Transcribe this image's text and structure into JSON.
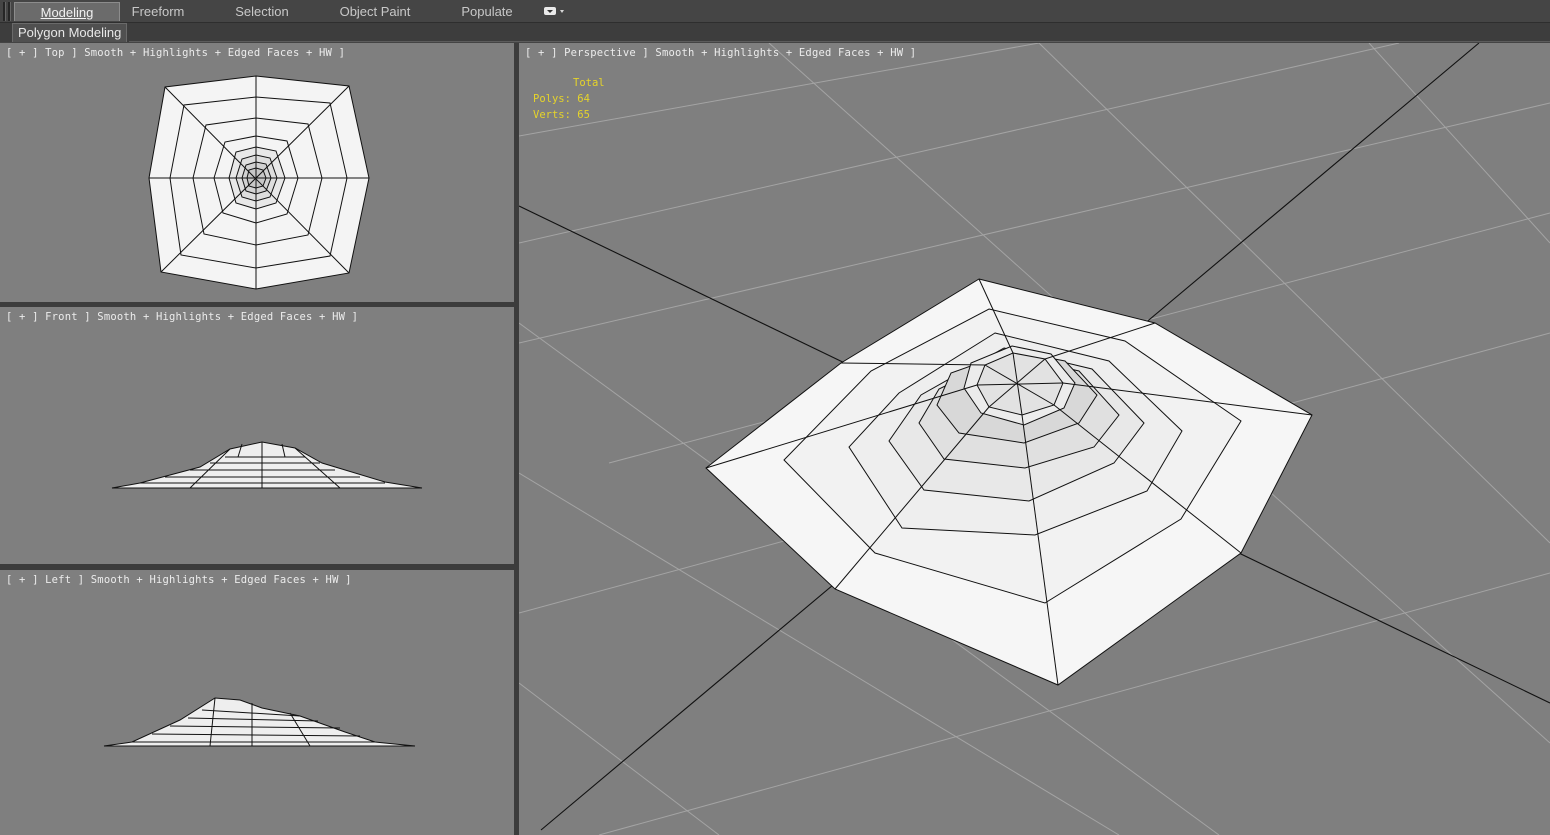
{
  "ribbon": {
    "tabs": [
      {
        "label": "Modeling",
        "active": true
      },
      {
        "label": "Freeform",
        "active": false
      },
      {
        "label": "Selection",
        "active": false
      },
      {
        "label": "Object Paint",
        "active": false
      },
      {
        "label": "Populate",
        "active": false
      }
    ],
    "overflow_icon": "display-dropdown-icon",
    "panel_title": "Polygon Modeling"
  },
  "viewports": {
    "top": {
      "label": "[ + ] Top ] Smooth + Highlights + Edged Faces + HW ]"
    },
    "front": {
      "label": "[ + ] Front ] Smooth + Highlights + Edged Faces + HW ]"
    },
    "left": {
      "label": "[ + ] Left ] Smooth + Highlights + Edged Faces + HW ]"
    },
    "perspective": {
      "label": "[ + ] Perspective ] Smooth + Highlights + Edged Faces + HW ]",
      "stats": {
        "header": "Total",
        "polys": "Polys: 64",
        "verts": "Verts: 65"
      }
    }
  },
  "colors": {
    "viewport_bg": "#7f7f7f",
    "stats_text": "#e6d42a",
    "mesh_fill": "#f4f4f4",
    "wire": "#111111"
  }
}
